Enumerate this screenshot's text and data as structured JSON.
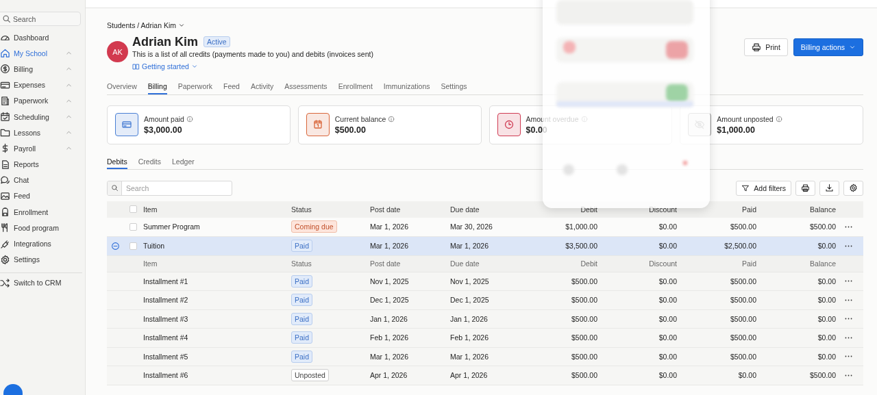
{
  "sidebar": {
    "search": {
      "placeholder": "Search"
    },
    "items": [
      {
        "label": "Dashboard",
        "kind": "link",
        "selected": false
      },
      {
        "label": "My School",
        "kind": "group",
        "selected": true
      },
      {
        "label": "Billing",
        "kind": "group",
        "selected": false
      },
      {
        "label": "Expenses",
        "kind": "group",
        "selected": false
      },
      {
        "label": "Paperwork",
        "kind": "group",
        "selected": false
      },
      {
        "label": "Scheduling",
        "kind": "group",
        "selected": false
      },
      {
        "label": "Lessons",
        "kind": "group",
        "selected": false
      },
      {
        "label": "Payroll",
        "kind": "group",
        "selected": false
      },
      {
        "label": "Reports",
        "kind": "link",
        "selected": false
      },
      {
        "label": "Chat",
        "kind": "link",
        "selected": false
      },
      {
        "label": "Feed",
        "kind": "link",
        "selected": false
      },
      {
        "label": "Enrollment",
        "kind": "link",
        "selected": false
      },
      {
        "label": "Food program",
        "kind": "link",
        "selected": false
      },
      {
        "label": "Integrations",
        "kind": "link",
        "selected": false
      },
      {
        "label": "Settings",
        "kind": "link",
        "selected": false
      }
    ],
    "switch_label": "Switch to CRM"
  },
  "header": {
    "breadcrumb": "Students / Adrian Kim",
    "avatar_initials": "AK",
    "name": "Adrian Kim",
    "status": "Active",
    "description": "This is a list of all credits (payments made to you) and debits (invoices sent)",
    "getting_started": "Getting started",
    "buttons": [
      {
        "label": "Print",
        "kind": "secondary"
      },
      {
        "label": "Billing actions",
        "kind": "primary"
      }
    ]
  },
  "tabs": [
    {
      "label": "Overview",
      "selected": false
    },
    {
      "label": "Billing",
      "selected": true
    },
    {
      "label": "Paperwork",
      "selected": false
    },
    {
      "label": "Feed",
      "selected": false
    },
    {
      "label": "Activity",
      "selected": false
    },
    {
      "label": "Assessments",
      "selected": false
    },
    {
      "label": "Enrollment",
      "selected": false
    },
    {
      "label": "Immunizations",
      "selected": false
    },
    {
      "label": "Settings",
      "selected": false
    }
  ],
  "stats": [
    {
      "label": "Amount paid",
      "value": "$3,000.00",
      "color": "#4a7fd4"
    },
    {
      "label": "Current balance",
      "value": "$500.00",
      "color": "#d9663a"
    },
    {
      "label": "Amount overdue",
      "value": "$0.00",
      "color": "#cf3b53"
    },
    {
      "label": "Amount unposted",
      "value": "$1,000.00",
      "color": "#9a9a9a"
    }
  ],
  "subtabs": [
    {
      "label": "Debits",
      "selected": true
    },
    {
      "label": "Credits",
      "selected": false
    },
    {
      "label": "Ledger",
      "selected": false
    }
  ],
  "table_search": {
    "placeholder": "Search"
  },
  "add_filters": "Add filters",
  "table": {
    "select_all": {
      "checked": false
    },
    "columns": [
      "Item",
      "Status",
      "Post date",
      "Due date",
      "Debit",
      "Discount",
      "Paid",
      "Balance"
    ],
    "rows": [
      {
        "kind": "item",
        "selected": false,
        "checked": false,
        "item": "Summer Program",
        "status": {
          "label": "Coming due",
          "kind": "coming_due"
        },
        "post_date": "Mar 1, 2026",
        "due_date": "Mar 30, 2026",
        "debit": "$1,000.00",
        "discount": "$0.00",
        "paid": "$500.00",
        "balance": "$500.00"
      },
      {
        "kind": "plan",
        "expanded": true,
        "selected": true,
        "checked": false,
        "item": "Tuition",
        "status": {
          "label": "Paid",
          "kind": "paid"
        },
        "post_date": "Mar 1, 2026",
        "due_date": "Mar 1, 2026",
        "debit": "$3,500.00",
        "discount": "$0.00",
        "paid": "$2,500.00",
        "balance": "$0.00",
        "sub_columns": [
          "Item",
          "Status",
          "Post date",
          "Due date",
          "Debit",
          "Discount",
          "Paid",
          "Balance"
        ],
        "children": [
          {
            "item": "Installment #1",
            "status": {
              "label": "Paid",
              "kind": "paid"
            },
            "post_date": "Nov 1, 2025",
            "due_date": "Nov 1, 2025",
            "debit": "$500.00",
            "discount": "$0.00",
            "paid": "$500.00",
            "balance": "$0.00"
          },
          {
            "item": "Installment #2",
            "status": {
              "label": "Paid",
              "kind": "paid"
            },
            "post_date": "Dec 1, 2025",
            "due_date": "Dec 1, 2025",
            "debit": "$500.00",
            "discount": "$0.00",
            "paid": "$500.00",
            "balance": "$0.00"
          },
          {
            "item": "Installment #3",
            "status": {
              "label": "Paid",
              "kind": "paid"
            },
            "post_date": "Jan 1, 2026",
            "due_date": "Jan 1, 2026",
            "debit": "$500.00",
            "discount": "$0.00",
            "paid": "$500.00",
            "balance": "$0.00"
          },
          {
            "item": "Installment #4",
            "status": {
              "label": "Paid",
              "kind": "paid"
            },
            "post_date": "Feb 1, 2026",
            "due_date": "Feb 1, 2026",
            "debit": "$500.00",
            "discount": "$0.00",
            "paid": "$500.00",
            "balance": "$0.00"
          },
          {
            "item": "Installment #5",
            "status": {
              "label": "Paid",
              "kind": "paid"
            },
            "post_date": "Mar 1, 2026",
            "due_date": "Mar 1, 2026",
            "debit": "$500.00",
            "discount": "$0.00",
            "paid": "$500.00",
            "balance": "$0.00"
          },
          {
            "item": "Installment #6",
            "status": {
              "label": "Unposted",
              "kind": "unposted"
            },
            "post_date": "Apr 1, 2026",
            "due_date": "Apr 1, 2026",
            "debit": "$500.00",
            "discount": "$0.00",
            "paid": "$0.00",
            "balance": "$500.00"
          }
        ]
      }
    ]
  }
}
